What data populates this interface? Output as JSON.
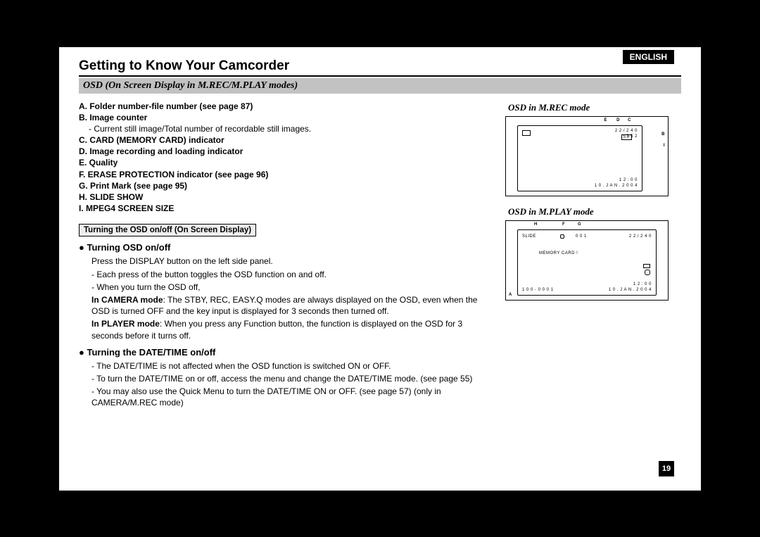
{
  "language": "ENGLISH",
  "page_title": "Getting to Know Your Camcorder",
  "subtitle": "OSD (On Screen Display in M.REC/M.PLAY modes)",
  "list": {
    "a": "A.  Folder number-file number (see page 87)",
    "b": "B.  Image counter",
    "b_note": "- Current still image/Total number of recordable still images.",
    "c": "C.  CARD (MEMORY CARD) indicator",
    "d": "D.  Image recording and loading indicator",
    "e": "E.  Quality",
    "f": "F.  ERASE PROTECTION indicator (see page 96)",
    "g": "G.  Print Mark (see page 95)",
    "h": "H.  SLIDE SHOW",
    "i": "I.    MPEG4 SCREEN SIZE"
  },
  "boxed_label": "Turning the OSD on/off (On Screen Display)",
  "section1_head": "● Turning OSD on/off",
  "section1_p1": "Press the DISPLAY button on the left side panel.",
  "section1_p2": "- Each press of the button toggles the OSD function on and off.",
  "section1_p3": "- When you turn the OSD off,",
  "section1_p4a": "In CAMERA mode",
  "section1_p4b": ": The STBY, REC, EASY.Q modes are always displayed on the OSD, even when the OSD is turned OFF and the key input is displayed for 3 seconds then turned off.",
  "section1_p5a": "In PLAYER mode",
  "section1_p5b": ": When you press any Function button, the function is displayed on the OSD for 3 seconds before it turns off.",
  "section2_head": "● Turning the DATE/TIME on/off",
  "section2_p1": "- The DATE/TIME is not affected when the OSD function is switched ON or OFF.",
  "section2_p2": "- To turn the DATE/TIME on or off, access the menu and change the DATE/TIME mode. (see page 55)",
  "section2_p3": "- You may also use the Quick Menu to turn the DATE/TIME ON or OFF. (see page 57) (only in CAMERA/M.REC mode)",
  "right": {
    "mrec_label": "OSD in M.REC mode",
    "mplay_label": "OSD in M.PLAY mode"
  },
  "osd1": {
    "E": "E",
    "D": "D",
    "C": "C",
    "B": "B",
    "I": "I",
    "counter": "2 2 / 2 4 0",
    "size": "3 5 2",
    "sf": "S F",
    "time": "1 2 : 0 0",
    "date": "1 0 . J A N . 2 0 0 4"
  },
  "osd2": {
    "H": "H",
    "F": "F",
    "G": "G",
    "A": "A",
    "slide": "SLIDE",
    "printmark": "0 0 1",
    "counter": "2 2 / 2 4 0",
    "memcard": "MEMORY CARD !",
    "folderfile": "1 0 0 - 0 0 0 1",
    "time": "1 2 : 0 0",
    "date": "1 0 . J A N . 2 0 0 4"
  },
  "page_number": "19"
}
